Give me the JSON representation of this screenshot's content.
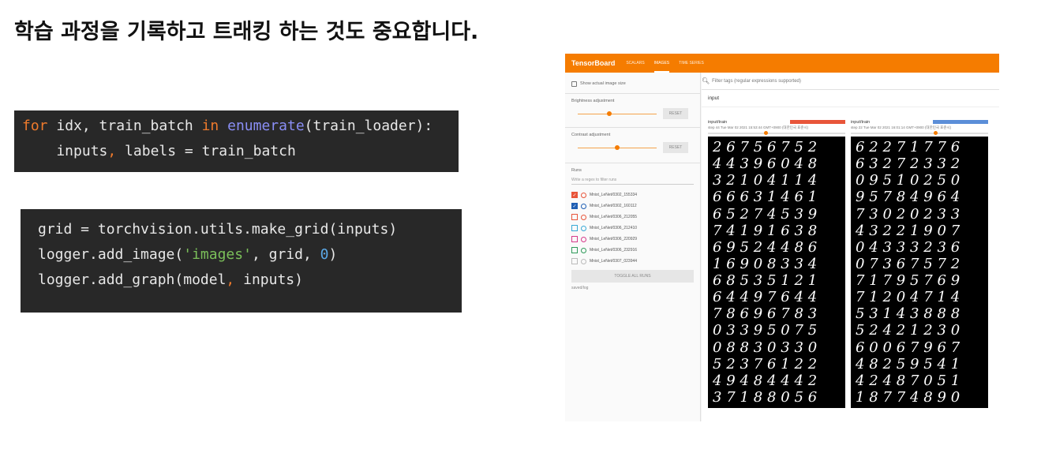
{
  "slide": {
    "title": "학습 과정을 기록하고 트래킹 하는 것도 중요합니다."
  },
  "code_block_1": {
    "lines": [
      [
        {
          "t": "for",
          "c": "kw"
        },
        {
          "t": " idx, train_batch ",
          "c": ""
        },
        {
          "t": "in",
          "c": "kw"
        },
        {
          "t": " ",
          "c": ""
        },
        {
          "t": "enumerate",
          "c": "fn"
        },
        {
          "t": "(train_loader):",
          "c": ""
        }
      ],
      [
        {
          "t": "    inputs",
          "c": ""
        },
        {
          "t": ",",
          "c": "kw"
        },
        {
          "t": " labels = train_batch",
          "c": ""
        }
      ]
    ]
  },
  "code_block_2": {
    "lines": [
      [
        {
          "t": "grid = torchvision.utils.make_grid(inputs)",
          "c": ""
        }
      ],
      [
        {
          "t": "logger.add_image(",
          "c": ""
        },
        {
          "t": "'images'",
          "c": "str"
        },
        {
          "t": ", grid, ",
          "c": ""
        },
        {
          "t": "0",
          "c": "num"
        },
        {
          "t": ")",
          "c": ""
        }
      ],
      [
        {
          "t": "logger.add_graph(model",
          "c": ""
        },
        {
          "t": ",",
          "c": "kw"
        },
        {
          "t": " inputs)",
          "c": ""
        }
      ]
    ]
  },
  "tensorboard": {
    "brand": "TensorBoard",
    "tabs": [
      {
        "label": "SCALARS",
        "active": false
      },
      {
        "label": "IMAGES",
        "active": true
      },
      {
        "label": "TIME SERIES",
        "active": false
      }
    ],
    "accent_color": "#f57c00",
    "sidebar": {
      "show_actual_size_label": "Show actual image size",
      "brightness_label": "Brightness adjustment",
      "brightness_value": 0.4,
      "contrast_label": "Contrast adjustment",
      "contrast_value": 0.5,
      "reset_label": "RESET",
      "runs_label": "Runs",
      "runs_filter_placeholder": "Write a regex to filter runs",
      "runs": [
        {
          "name": "Mnist_LeNet/0302_155334",
          "color": "#e8553a",
          "checked": true
        },
        {
          "name": "Mnist_LeNet/0302_160112",
          "color": "#1f5fb4",
          "checked": true
        },
        {
          "name": "Mnist_LeNet/0306_212055",
          "color": "#e8553a",
          "checked": false
        },
        {
          "name": "Mnist_LeNet/0306_212410",
          "color": "#38a9d6",
          "checked": false
        },
        {
          "name": "Mnist_LeNet/0306_220929",
          "color": "#d63b8a",
          "checked": false
        },
        {
          "name": "Mnist_LeNet/0306_232916",
          "color": "#2f9a5a",
          "checked": false
        },
        {
          "name": "Mnist_LeNet/0307_023944",
          "color": "#bbbbbb",
          "checked": false
        }
      ],
      "toggle_all_label": "TOGGLE ALL RUNS",
      "log_dir": "saved/log"
    },
    "main": {
      "filter_placeholder": "Filter tags (regular expressions supported)",
      "group_title": "input",
      "cards": [
        {
          "title": "input/train",
          "meta": "step 44    Tue Mar 02 2021 15:53:44 GMT+0900 (대한민국 표준시)",
          "badge_color": "#e8553a",
          "step_position": 0.42,
          "digits": [
            "26756752",
            "44396048",
            "32104114",
            "66631461",
            "65274539",
            "74191638",
            "69524486",
            "16908334",
            "68535121",
            "64497644",
            "78696783",
            "03395075",
            "08830330",
            "52376122",
            "49484442",
            "37188056"
          ]
        },
        {
          "title": "input/train",
          "meta": "step 22    Tue Mar 02 2021 16:01:14 GMT+0900 (대한민국 표준시)",
          "badge_color": "#5b8ed8",
          "step_position": 0.62,
          "digits": [
            "62271776",
            "63272332",
            "09510250",
            "95784964",
            "73020233",
            "43221907",
            "04333236",
            "07367572",
            "71795769",
            "71204714",
            "53143888",
            "52421230",
            "60067967",
            "48259541",
            "42487051",
            "18774890"
          ]
        }
      ]
    }
  }
}
